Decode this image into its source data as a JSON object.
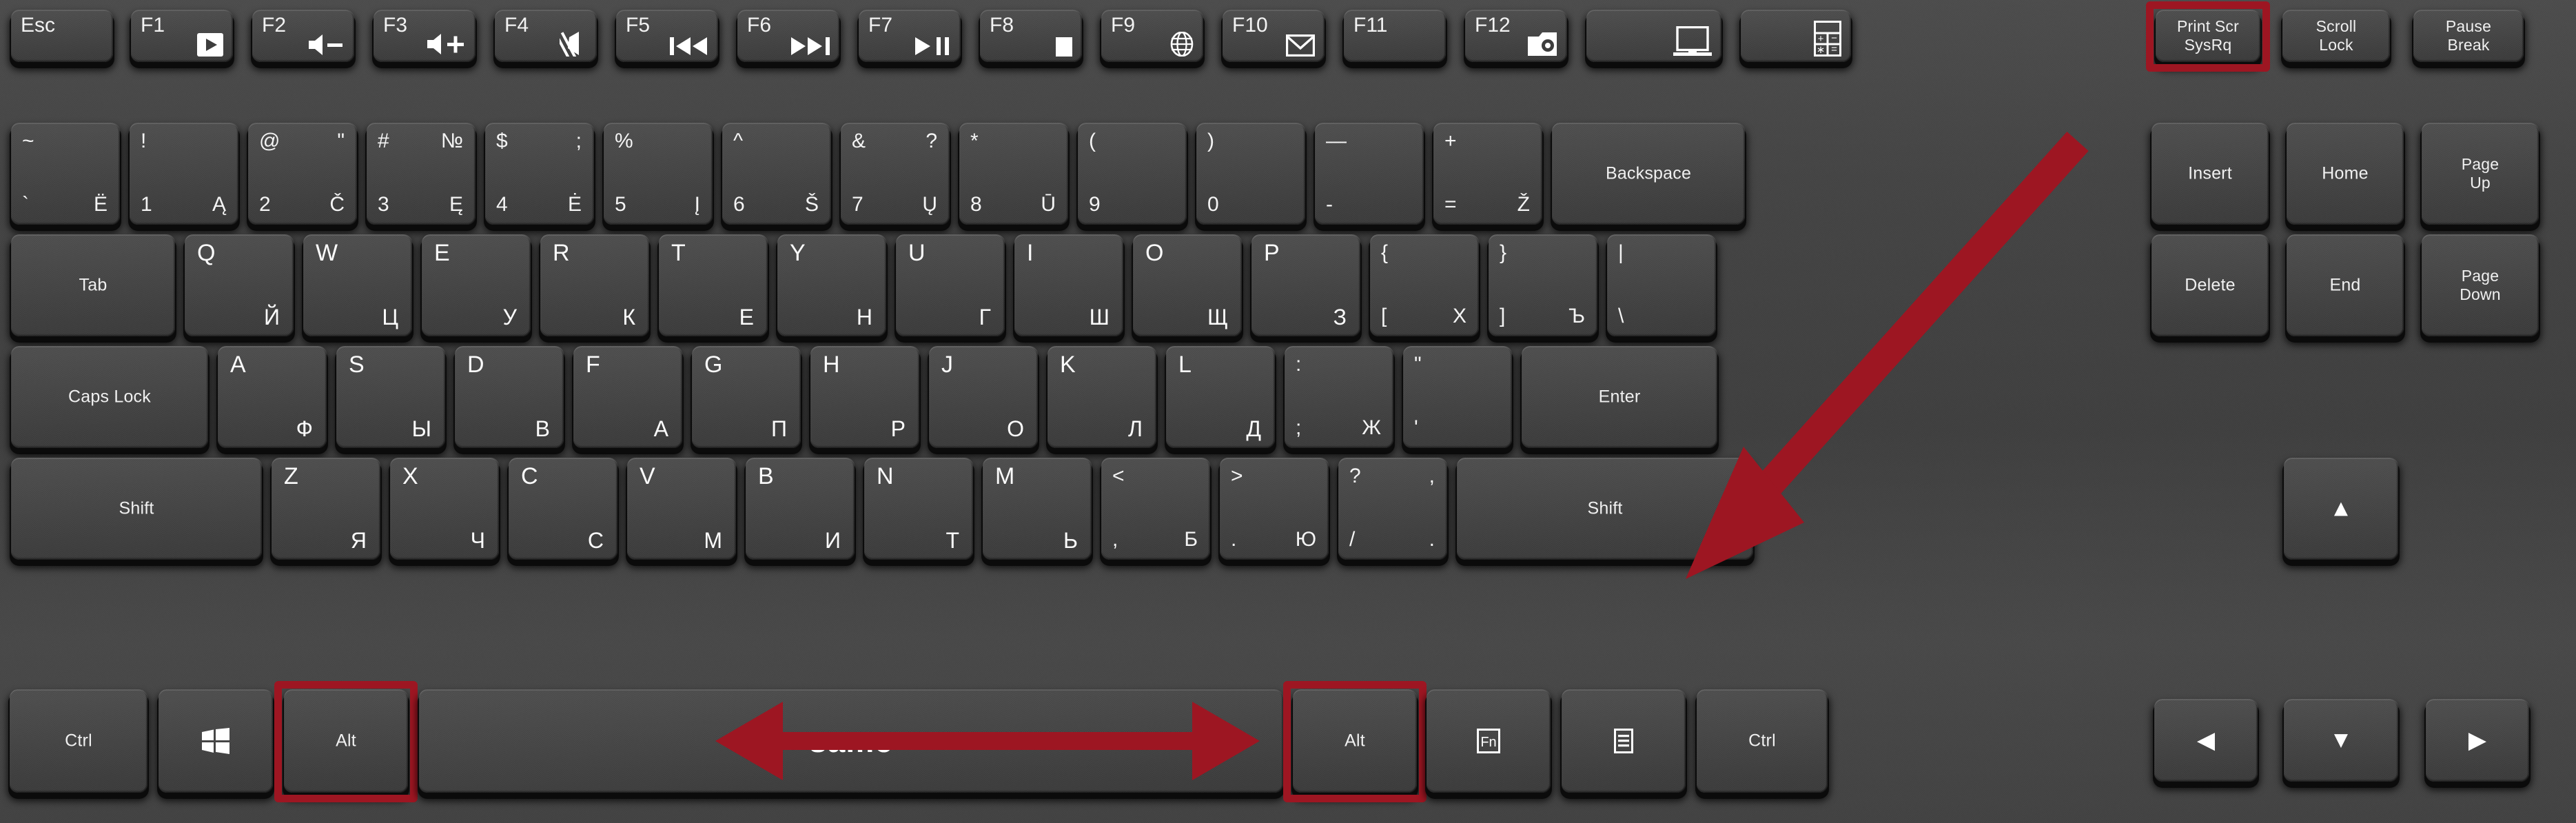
{
  "device": {
    "name": "Laptop keyboard (Russian / Lithuanian layout)",
    "accent_color": "#9d1622",
    "key_face_color": "#464646",
    "legend_color": "#f2f2f2"
  },
  "rows": {
    "function_row": [
      {
        "name": "esc",
        "label": "Esc"
      },
      {
        "name": "f1",
        "label": "F1",
        "glyph": "media-play-boxed-icon"
      },
      {
        "name": "f2",
        "label": "F2",
        "glyph": "volume-down-icon"
      },
      {
        "name": "f3",
        "label": "F3",
        "glyph": "volume-up-icon"
      },
      {
        "name": "f4",
        "label": "F4",
        "glyph": "mute-icon"
      },
      {
        "name": "f5",
        "label": "F5",
        "glyph": "previous-track-icon"
      },
      {
        "name": "f6",
        "label": "F6",
        "glyph": "next-track-icon"
      },
      {
        "name": "f7",
        "label": "F7",
        "glyph": "play-pause-icon"
      },
      {
        "name": "f8",
        "label": "F8",
        "glyph": "stop-icon"
      },
      {
        "name": "f9",
        "label": "F9",
        "glyph": "globe-icon"
      },
      {
        "name": "f10",
        "label": "F10",
        "glyph": "envelope-icon"
      },
      {
        "name": "f11",
        "label": "F11",
        "glyph": ""
      },
      {
        "name": "f12",
        "label": "F12",
        "glyph": "camera-folder-icon"
      },
      {
        "name": "display",
        "label": "",
        "glyph": "laptop-screen-icon"
      },
      {
        "name": "calculator",
        "label": "",
        "glyph": "calculator-icon"
      },
      {
        "name": "print-screen",
        "label": "Print Scr",
        "label2": "SysRq",
        "highlight": true
      },
      {
        "name": "scroll-lock",
        "label": "Scroll",
        "label2": "Lock"
      },
      {
        "name": "pause-break",
        "label": "Pause",
        "label2": "Break"
      }
    ],
    "number_row": [
      {
        "name": "backquote",
        "tl": "~",
        "tr": "",
        "bl": "`",
        "br": "Ё"
      },
      {
        "name": "digit1",
        "tl": "!",
        "tr": "",
        "bl": "1",
        "br": "Ą"
      },
      {
        "name": "digit2",
        "tl": "@",
        "tr": "\"",
        "bl": "2",
        "br": "Č"
      },
      {
        "name": "digit3",
        "tl": "#",
        "tr": "№",
        "bl": "3",
        "br": "Ę"
      },
      {
        "name": "digit4",
        "tl": "$",
        "tr": ";",
        "bl": "4",
        "br": "Ė"
      },
      {
        "name": "digit5",
        "tl": "%",
        "tr": "",
        "bl": "5",
        "br": "Į"
      },
      {
        "name": "digit6",
        "tl": "^",
        "tr": "",
        "bl": "6",
        "br": "Š"
      },
      {
        "name": "digit7",
        "tl": "&",
        "tr": "?",
        "bl": "7",
        "br": "Ų"
      },
      {
        "name": "digit8",
        "tl": "*",
        "tr": "",
        "bl": "8",
        "br": "Ū"
      },
      {
        "name": "digit9",
        "tl": "(",
        "tr": "",
        "bl": "9",
        "br": ""
      },
      {
        "name": "digit0",
        "tl": ")",
        "tr": "",
        "bl": "0",
        "br": ""
      },
      {
        "name": "minus",
        "tl": "—",
        "tr": "",
        "bl": "-",
        "br": ""
      },
      {
        "name": "equal",
        "tl": "+",
        "tr": "",
        "bl": "=",
        "br": "Ž"
      },
      {
        "name": "backspace",
        "label": "Backspace"
      }
    ],
    "nav_block_row2": [
      {
        "name": "insert",
        "label": "Insert"
      },
      {
        "name": "home",
        "label": "Home"
      },
      {
        "name": "page-up",
        "label": "Page",
        "label2": "Up"
      }
    ],
    "qwerty_row": [
      {
        "name": "tab",
        "label": "Tab"
      },
      {
        "name": "key-q",
        "lat": "Q",
        "cyr": "Й"
      },
      {
        "name": "key-w",
        "lat": "W",
        "cyr": "Ц"
      },
      {
        "name": "key-e",
        "lat": "E",
        "cyr": "У"
      },
      {
        "name": "key-r",
        "lat": "R",
        "cyr": "К"
      },
      {
        "name": "key-t",
        "lat": "T",
        "cyr": "Е"
      },
      {
        "name": "key-y",
        "lat": "Y",
        "cyr": "Н"
      },
      {
        "name": "key-u",
        "lat": "U",
        "cyr": "Г"
      },
      {
        "name": "key-i",
        "lat": "I",
        "cyr": "Ш"
      },
      {
        "name": "key-o",
        "lat": "O",
        "cyr": "Щ"
      },
      {
        "name": "key-p",
        "lat": "P",
        "cyr": "З"
      },
      {
        "name": "bracket-left",
        "tl": "{",
        "tr": "",
        "bl": "[",
        "br": "Х"
      },
      {
        "name": "bracket-right",
        "tl": "}",
        "tr": "",
        "bl": "]",
        "br": "Ъ"
      },
      {
        "name": "backslash",
        "tl": "|",
        "tr": "",
        "bl": "\\",
        "br": ""
      }
    ],
    "nav_block_row3": [
      {
        "name": "delete",
        "label": "Delete"
      },
      {
        "name": "end",
        "label": "End"
      },
      {
        "name": "page-down",
        "label": "Page",
        "label2": "Down"
      }
    ],
    "home_row": [
      {
        "name": "caps-lock",
        "label": "Caps Lock"
      },
      {
        "name": "key-a",
        "lat": "A",
        "cyr": "Ф"
      },
      {
        "name": "key-s",
        "lat": "S",
        "cyr": "Ы"
      },
      {
        "name": "key-d",
        "lat": "D",
        "cyr": "В"
      },
      {
        "name": "key-f",
        "lat": "F",
        "cyr": "А"
      },
      {
        "name": "key-g",
        "lat": "G",
        "cyr": "П"
      },
      {
        "name": "key-h",
        "lat": "H",
        "cyr": "Р"
      },
      {
        "name": "key-j",
        "lat": "J",
        "cyr": "О"
      },
      {
        "name": "key-k",
        "lat": "K",
        "cyr": "Л"
      },
      {
        "name": "key-l",
        "lat": "L",
        "cyr": "Д"
      },
      {
        "name": "semicolon",
        "tl": ":",
        "tr": "",
        "bl": ";",
        "br": "Ж"
      },
      {
        "name": "quote",
        "tl": "\"",
        "tr": "",
        "bl": "'",
        "br": ""
      },
      {
        "name": "enter",
        "label": "Enter"
      }
    ],
    "shift_row": [
      {
        "name": "shift-left",
        "label": "Shift"
      },
      {
        "name": "key-z",
        "lat": "Z",
        "cyr": "Я"
      },
      {
        "name": "key-x",
        "lat": "X",
        "cyr": "Ч"
      },
      {
        "name": "key-c",
        "lat": "C",
        "cyr": "С"
      },
      {
        "name": "key-v",
        "lat": "V",
        "cyr": "М"
      },
      {
        "name": "key-b",
        "lat": "B",
        "cyr": "И"
      },
      {
        "name": "key-n",
        "lat": "N",
        "cyr": "Т"
      },
      {
        "name": "key-m",
        "lat": "M",
        "cyr": "Ь"
      },
      {
        "name": "comma",
        "tl": "<",
        "tr": "",
        "bl": ",",
        "br": "Б"
      },
      {
        "name": "period",
        "tl": ">",
        "tr": "",
        "bl": ".",
        "br": "Ю"
      },
      {
        "name": "slash",
        "tl": "?",
        "tr": ",",
        "bl": "/",
        "br": "."
      },
      {
        "name": "shift-right",
        "label": "Shift"
      },
      {
        "name": "arrow-up",
        "glyph": "▲"
      }
    ],
    "bottom_row": [
      {
        "name": "ctrl-left",
        "label": "Ctrl"
      },
      {
        "name": "windows",
        "glyph": "windows-logo-icon"
      },
      {
        "name": "alt-left",
        "label": "Alt",
        "highlight": true
      },
      {
        "name": "space",
        "label": "same"
      },
      {
        "name": "alt-right",
        "label": "Alt",
        "highlight": true
      },
      {
        "name": "fn",
        "glyph": "fn-boxed-icon"
      },
      {
        "name": "menu",
        "glyph": "context-menu-icon"
      },
      {
        "name": "ctrl-right",
        "label": "Ctrl"
      },
      {
        "name": "arrow-left",
        "glyph": "◀"
      },
      {
        "name": "arrow-down",
        "glyph": "▼"
      },
      {
        "name": "arrow-right",
        "glyph": "▶"
      }
    ]
  },
  "annotations": {
    "highlight_print_screen": "Print Scr / SysRq key outlined in red",
    "highlight_alt_left": "Left Alt key outlined in red",
    "highlight_alt_right": "Right Alt key outlined in red",
    "arrow_to_slash_key": "Long red arrow pointing from upper right down to the ? / . key",
    "spacebar_double_arrow": "Red double-headed horizontal arrow spanning the spacebar"
  }
}
